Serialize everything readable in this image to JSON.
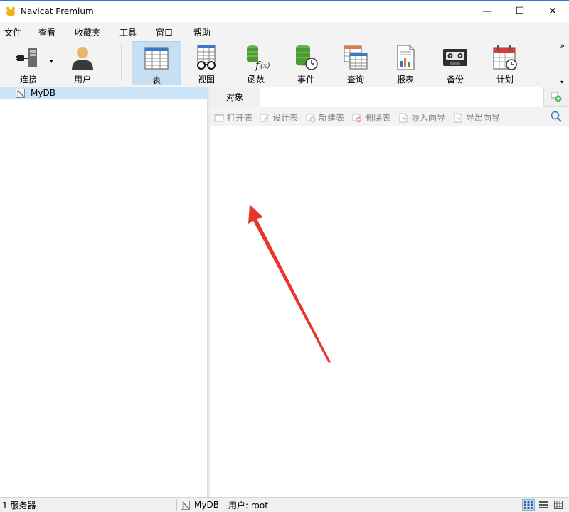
{
  "window": {
    "title": "Navicat Premium",
    "minimize": "—",
    "maximize": "☐",
    "close": "✕"
  },
  "menu": [
    "文件",
    "查看",
    "收藏夹",
    "工具",
    "窗口",
    "帮助"
  ],
  "toolbar": {
    "items": [
      {
        "label": "连接",
        "icon": "connection-plug-icon"
      },
      {
        "label": "用户",
        "icon": "user-icon"
      },
      {
        "label": "表",
        "icon": "table-icon",
        "active": true
      },
      {
        "label": "视图",
        "icon": "view-glasses-icon"
      },
      {
        "label": "函数",
        "icon": "function-fx-icon"
      },
      {
        "label": "事件",
        "icon": "event-clock-icon"
      },
      {
        "label": "查询",
        "icon": "query-icon"
      },
      {
        "label": "报表",
        "icon": "report-icon"
      },
      {
        "label": "备份",
        "icon": "backup-tape-icon"
      },
      {
        "label": "计划",
        "icon": "schedule-calendar-icon"
      }
    ],
    "more": "»",
    "dropdown_arrow": "▾"
  },
  "tree": {
    "selected": "MyDB"
  },
  "tabs": {
    "object_tab": "对象"
  },
  "object_toolbar": {
    "buttons": [
      "打开表",
      "设计表",
      "新建表",
      "删除表",
      "导入向导",
      "导出向导"
    ]
  },
  "status": {
    "servers": "1 服务器",
    "db": "MyDB",
    "user": "用户: root"
  },
  "colors": {
    "accent": "#2b79d8",
    "selection": "#cce4f7",
    "annotation_arrow": "#e8362a"
  }
}
